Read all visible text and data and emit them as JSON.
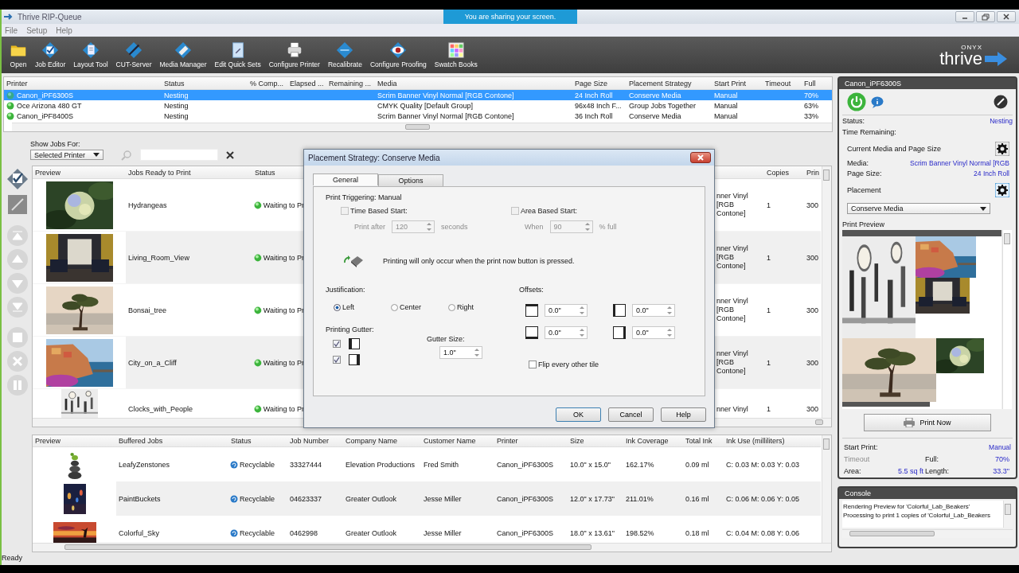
{
  "window": {
    "title": "Thrive RIP-Queue",
    "sharing_banner": "You are sharing your screen."
  },
  "menu": [
    "File",
    "Setup",
    "Help"
  ],
  "toolbar": [
    "Open",
    "Job Editor",
    "Layout Tool",
    "CUT-Server",
    "Media Manager",
    "Edit Quick Sets",
    "Configure Printer",
    "Recalibrate",
    "Configure Proofing",
    "Swatch Books"
  ],
  "logo": {
    "brand": "ONYX",
    "name": "thrive"
  },
  "printers": {
    "columns": [
      "Printer",
      "Status",
      "% Comp...",
      "Elapsed ...",
      "Remaining ...",
      "Media",
      "Page Size",
      "Placement Strategy",
      "Start Print",
      "Timeout",
      "Full"
    ],
    "rows": [
      {
        "selected": true,
        "printer": "Canon_iPF6300S",
        "status": "Nesting",
        "media": "Scrim Banner Vinyl Normal [RGB Contone]",
        "page_size": "24 Inch Roll",
        "placement_strategy": "Conserve Media",
        "start_print": "Manual",
        "full": "70%"
      },
      {
        "selected": false,
        "printer": "Oce Arizona 480 GT",
        "status": "Nesting",
        "media": "CMYK Quality [Default Group]",
        "page_size": "96x48 Inch F...",
        "placement_strategy": "Group Jobs Together",
        "start_print": "Manual",
        "full": "63%"
      },
      {
        "selected": false,
        "printer": "Canon_iPF8400S",
        "status": "Nesting",
        "media": "Scrim Banner Vinyl Normal [RGB Contone]",
        "page_size": "36 Inch Roll",
        "placement_strategy": "Conserve Media",
        "start_print": "Manual",
        "full": "33%"
      }
    ]
  },
  "jobs": {
    "filter_label": "Show Jobs For:",
    "filter_value": "Selected Printer",
    "columns": {
      "preview": "Preview",
      "name": "Jobs Ready to Print",
      "status": "Status",
      "copies": "Copies",
      "column_6": "Prin"
    },
    "rows": [
      {
        "name": "Hydrangeas",
        "status": "Waiting to Pr",
        "column_4": [
          "nner Vinyl",
          "[RGB Contone]"
        ],
        "copies": "1",
        "column_6": "300"
      },
      {
        "name": "Living_Room_View",
        "status": "Waiting to Pr",
        "column_4": [
          "nner Vinyl",
          "[RGB Contone]"
        ],
        "copies": "1",
        "column_6": "300"
      },
      {
        "name": "Bonsai_tree",
        "status": "Waiting to Pr",
        "column_4": [
          "nner Vinyl",
          "[RGB Contone]"
        ],
        "copies": "1",
        "column_6": "300"
      },
      {
        "name": "City_on_a_Cliff",
        "status": "Waiting to Pr",
        "column_4": [
          "nner Vinyl",
          "[RGB Contone]"
        ],
        "copies": "1",
        "column_6": "300"
      },
      {
        "name": "Clocks_with_People",
        "status": "Waiting to Pr",
        "column_4": [
          "nner Vinyl"
        ],
        "copies": "1",
        "column_6": "300"
      }
    ]
  },
  "dialog": {
    "title": "Placement Strategy: Conserve Media",
    "tabs": [
      {
        "label": "General",
        "selected": true
      },
      {
        "label": "Options",
        "selected": false
      }
    ],
    "print_triggering": "Print Triggering: Manual",
    "time_start": {
      "label": "Time Based Start:",
      "checked": false,
      "disabled": true,
      "prefix": "Print after",
      "value": "120",
      "suffix": "seconds"
    },
    "area_start": {
      "label": "Area Based Start:",
      "checked": false,
      "disabled": true,
      "prefix": "When",
      "value": "90",
      "suffix": "% full"
    },
    "note": "Printing will only occur when the print now button is pressed.",
    "justification": {
      "label": "Justification:",
      "options": [
        {
          "label": "Left",
          "selected": true
        },
        {
          "label": "Center",
          "selected": false
        },
        {
          "label": "Right",
          "selected": false
        }
      ]
    },
    "offsets": {
      "label": "Offsets:",
      "values": [
        "0.0\"",
        "0.0\"",
        "0.0\"",
        "0.0\""
      ]
    },
    "gutter": {
      "label": "Printing Gutter:",
      "items": [
        {
          "checked": true
        },
        {
          "checked": true
        }
      ],
      "size_label": "Gutter Size:",
      "size": "1.0\""
    },
    "flip": {
      "label": "Flip every other tile",
      "checked": false
    },
    "buttons": [
      "OK",
      "Cancel",
      "Help"
    ]
  },
  "printer_panel": {
    "title": "Canon_iPF6300S",
    "status_label": "Status:",
    "status": "Nesting",
    "time_remaining_label": "Time Remaining:",
    "media_section": "Current Media and Page Size",
    "media_label": "Media:",
    "media": "Scrim Banner Vinyl Normal [RGB",
    "page_size_label": "Page Size:",
    "page_size": "24 Inch Roll",
    "placement_label": "Placement",
    "placement": "Conserve Media",
    "preview_label": "Print Preview",
    "print_now": "Print Now",
    "start_print_label": "Start Print:",
    "start_print": "Manual",
    "timeout": {
      "label": "Timeout",
      "disabled": true
    },
    "full_label": "Full:",
    "full": "70%",
    "area_label": "Area:",
    "area": "5.5 sq ft",
    "length_label": "Length:",
    "length": "33.3\""
  },
  "console": {
    "title": "Console",
    "lines": [
      "Rendering Preview for 'Colorful_Lab_Beakers'",
      "Processing to print 1 copies of 'Colorful_Lab_Beakers"
    ]
  },
  "buffered": {
    "columns": [
      "Preview",
      "Buffered Jobs",
      "Status",
      "Job Number",
      "Company Name",
      "Customer Name",
      "Printer",
      "Size",
      "Ink Coverage",
      "Total Ink",
      "Ink Use (milliliters)"
    ],
    "rows": [
      {
        "cells": [
          {
            "kind": "picture"
          },
          "LeafyZenstones",
          "Recyclable",
          "33327444",
          "Elevation Productions",
          "Fred Smith",
          "Canon_iPF6300S",
          "10.0\" x 15.0\"",
          "162.17%",
          "0.09 ml",
          "C: 0.03 M: 0.03 Y: 0.03"
        ]
      },
      {
        "cells": [
          {
            "kind": "picture"
          },
          "PaintBuckets",
          "Recyclable",
          "04623337",
          "Greater Outlook",
          "Jesse Miller",
          "Canon_iPF6300S",
          "12.0\" x 17.73\"",
          "211.01%",
          "0.16 ml",
          "C: 0.06 M: 0.06 Y: 0.05"
        ]
      },
      {
        "cells": [
          {
            "kind": "picture"
          },
          "Colorful_Sky",
          "Recyclable",
          "0462998",
          "Greater Outlook",
          "Jesse Miller",
          "Canon_iPF6300S",
          "18.0\" x 13.61\"",
          "198.52%",
          "0.18 ml",
          "C: 0.04 M: 0.08 Y: 0.06"
        ]
      }
    ]
  },
  "status_bar": "Ready"
}
